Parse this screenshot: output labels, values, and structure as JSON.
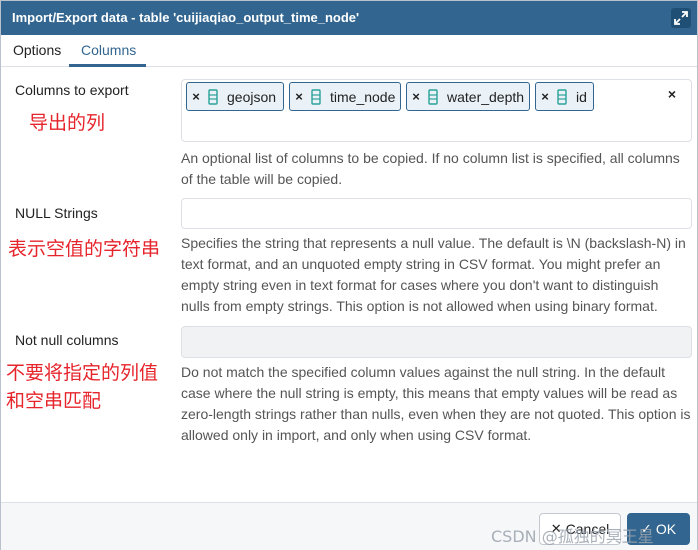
{
  "window": {
    "title": "Import/Export data - table 'cuijiaqiao_output_time_node'",
    "maximize_icon": "expand-arrows-icon"
  },
  "tabs": [
    {
      "label": "Options",
      "active": false
    },
    {
      "label": "Columns",
      "active": true
    }
  ],
  "columns_to_export": {
    "label": "Columns to export",
    "annotation": "导出的列",
    "chips": [
      {
        "remove_glyph": "×",
        "icon": "column-icon",
        "label": "geojson"
      },
      {
        "remove_glyph": "×",
        "icon": "column-icon",
        "label": "time_node"
      },
      {
        "remove_glyph": "×",
        "icon": "column-icon",
        "label": "water_depth"
      },
      {
        "remove_glyph": "×",
        "icon": "column-icon",
        "label": "id"
      }
    ],
    "clear_all_glyph": "×",
    "help": "An optional list of columns to be copied. If no column list is specified, all columns of the table will be copied."
  },
  "null_strings": {
    "label": "NULL Strings",
    "annotation": "表示空值的字符串",
    "value": "",
    "help": "Specifies the string that represents a null value. The default is \\N (backslash-N) in text format, and an unquoted empty string in CSV format. You might prefer an empty string even in text format for cases where you don't want to distinguish nulls from empty strings. This option is not allowed when using binary format."
  },
  "not_null_columns": {
    "label": "Not null columns",
    "annotation_line1": "不要将指定的列值",
    "annotation_line2": "和空串匹配",
    "value": "",
    "help": "Do not match the specified column values against the null string. In the default case where the null string is empty, this means that empty values will be read as zero-length strings rather than nulls, even when they are not quoted. This option is allowed only in import, and only when using CSV format."
  },
  "footer": {
    "watermark": "CSDN @孤独的冥王星",
    "cancel_label": "Cancel",
    "cancel_icon": "close-icon",
    "ok_label": "OK",
    "ok_icon": "check-icon"
  },
  "colors": {
    "accent": "#326690",
    "annotation_red": "#e6242b"
  }
}
